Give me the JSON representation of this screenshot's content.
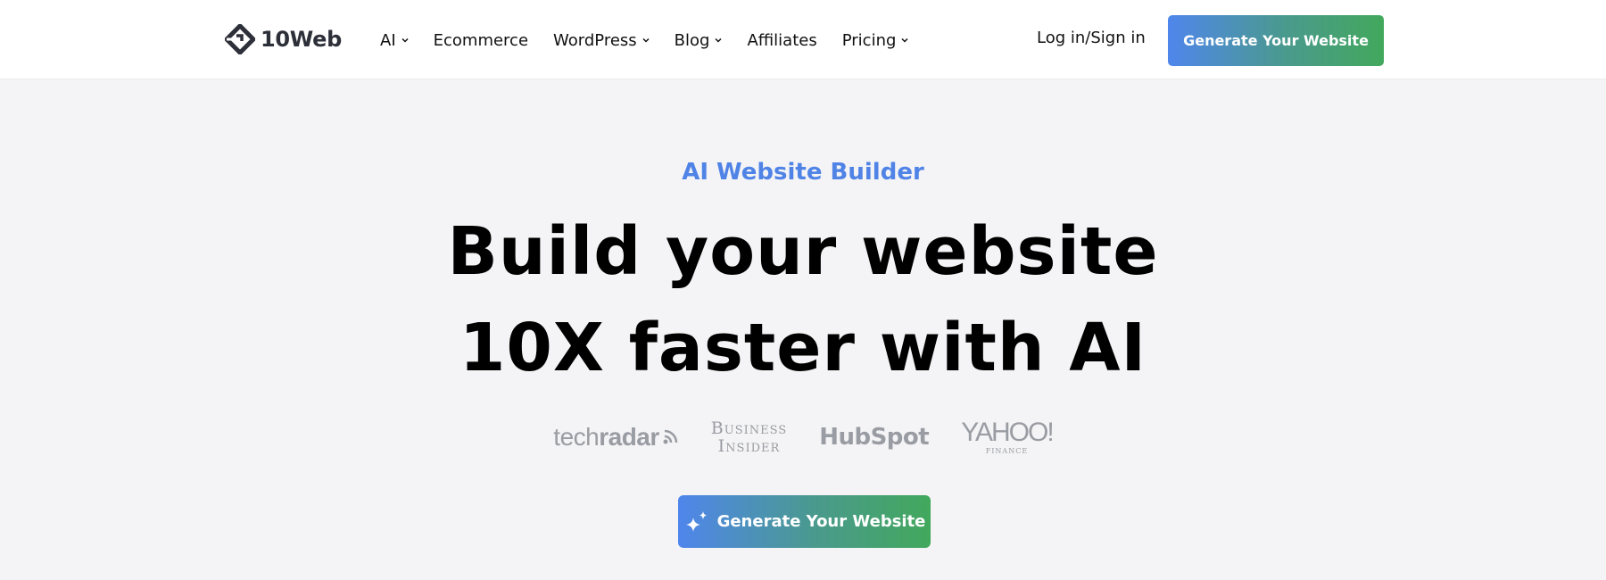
{
  "header": {
    "logo_text": "10Web",
    "nav": [
      {
        "label": "AI",
        "has_dropdown": true
      },
      {
        "label": "Ecommerce",
        "has_dropdown": false
      },
      {
        "label": "WordPress",
        "has_dropdown": true
      },
      {
        "label": "Blog",
        "has_dropdown": true
      },
      {
        "label": "Affiliates",
        "has_dropdown": false
      },
      {
        "label": "Pricing",
        "has_dropdown": true
      }
    ],
    "login_label": "Log in/Sign in",
    "cta_label": "Generate Your Website"
  },
  "hero": {
    "eyebrow": "AI Website Builder",
    "headline_line1": "Build your website",
    "headline_line2": "10X faster with AI",
    "press": {
      "techradar_a": "tech",
      "techradar_b": "radar",
      "business_insider_1": "Business",
      "business_insider_2": "Insider",
      "hubspot": "HubSpot",
      "yahoo": "YAHOO!",
      "yahoo_sub": "FINANCE"
    },
    "cta_label": "Generate Your Website"
  },
  "colors": {
    "accent_blue": "#4f83e6",
    "gradient_start": "#4f86ec",
    "gradient_end": "#42a85c",
    "background": "#f4f4f6",
    "press_gray": "#9a9ca3"
  }
}
